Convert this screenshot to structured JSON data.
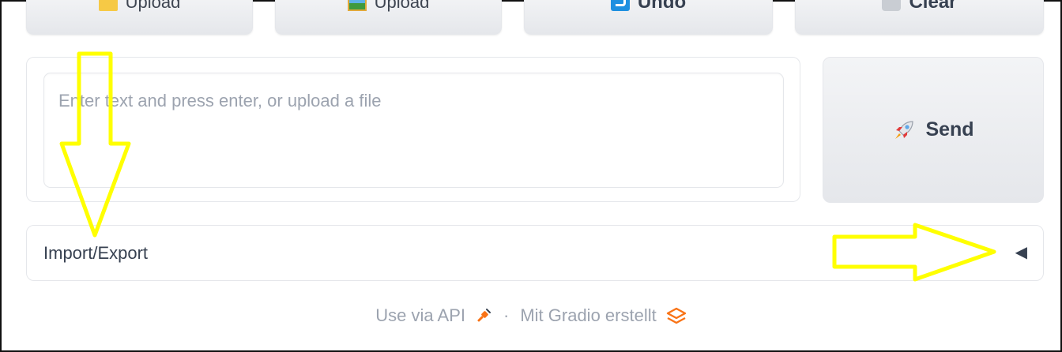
{
  "toolbar": {
    "buttons": [
      {
        "label": "Upload",
        "icon": "folder-icon"
      },
      {
        "label": "Upload",
        "icon": "image-icon"
      },
      {
        "label": "Undo",
        "icon": "undo-arrow-icon"
      },
      {
        "label": "Clear",
        "icon": "wastebasket-icon"
      }
    ]
  },
  "chat_input": {
    "placeholder": "Enter text and press enter, or upload a file",
    "value": ""
  },
  "send_button": {
    "label": "Send",
    "icon": "rocket-icon"
  },
  "accordion": {
    "title": "Import/Export",
    "toggle_glyph": "◀",
    "expanded": false
  },
  "footer": {
    "api_link": "Use via API",
    "separator": "·",
    "made_with": "Mit Gradio erstellt"
  },
  "colors": {
    "annotation_arrow": "#ffff00",
    "button_bg": "#e5e7eb",
    "placeholder_text": "#9ca3af",
    "gradio_orange": "#f97316"
  }
}
